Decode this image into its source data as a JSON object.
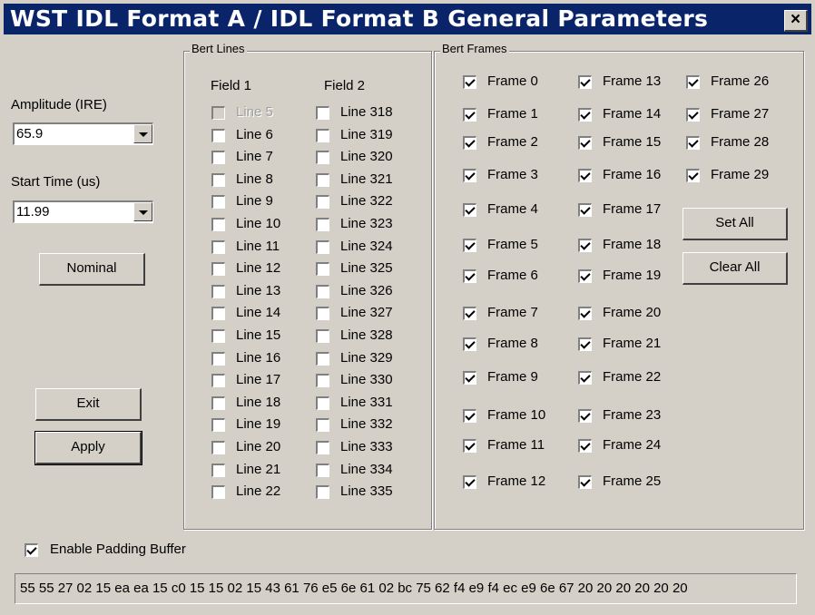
{
  "window": {
    "title": "WST IDL Format A / IDL Format B General Parameters",
    "close_label": "×"
  },
  "left": {
    "amplitude_label": "Amplitude (IRE)",
    "amplitude_value": "65.9",
    "start_time_label": "Start Time (us)",
    "start_time_value": "11.99",
    "nominal_label": "Nominal",
    "exit_label": "Exit",
    "apply_label": "Apply"
  },
  "bert_lines": {
    "legend": "Bert Lines",
    "field1_label": "Field 1",
    "field2_label": "Field 2",
    "field1": [
      {
        "label": "Line 5",
        "checked": false,
        "disabled": true
      },
      {
        "label": "Line 6",
        "checked": false
      },
      {
        "label": "Line 7",
        "checked": false
      },
      {
        "label": "Line 8",
        "checked": false
      },
      {
        "label": "Line 9",
        "checked": false
      },
      {
        "label": "Line 10",
        "checked": false
      },
      {
        "label": "Line 11",
        "checked": false
      },
      {
        "label": "Line 12",
        "checked": false
      },
      {
        "label": "Line 13",
        "checked": false
      },
      {
        "label": "Line 14",
        "checked": false
      },
      {
        "label": "Line 15",
        "checked": false
      },
      {
        "label": "Line 16",
        "checked": false
      },
      {
        "label": "Line 17",
        "checked": false
      },
      {
        "label": "Line 18",
        "checked": false
      },
      {
        "label": "Line 19",
        "checked": false
      },
      {
        "label": "Line 20",
        "checked": false
      },
      {
        "label": "Line 21",
        "checked": false
      },
      {
        "label": "Line 22",
        "checked": false
      }
    ],
    "field2": [
      {
        "label": "Line 318",
        "checked": false
      },
      {
        "label": "Line 319",
        "checked": false
      },
      {
        "label": "Line 320",
        "checked": false
      },
      {
        "label": "Line 321",
        "checked": false
      },
      {
        "label": "Line 322",
        "checked": false
      },
      {
        "label": "Line 323",
        "checked": false
      },
      {
        "label": "Line 324",
        "checked": false
      },
      {
        "label": "Line 325",
        "checked": false
      },
      {
        "label": "Line 326",
        "checked": false
      },
      {
        "label": "Line 327",
        "checked": false
      },
      {
        "label": "Line 328",
        "checked": false
      },
      {
        "label": "Line 329",
        "checked": false
      },
      {
        "label": "Line 330",
        "checked": false
      },
      {
        "label": "Line 331",
        "checked": false
      },
      {
        "label": "Line 332",
        "checked": false
      },
      {
        "label": "Line 333",
        "checked": false
      },
      {
        "label": "Line 334",
        "checked": false
      },
      {
        "label": "Line 335",
        "checked": false
      }
    ]
  },
  "bert_frames": {
    "legend": "Bert Frames",
    "set_all_label": "Set All",
    "clear_all_label": "Clear All",
    "frames": [
      {
        "label": "Frame 0",
        "checked": true
      },
      {
        "label": "Frame 1",
        "checked": true
      },
      {
        "label": "Frame 2",
        "checked": true
      },
      {
        "label": "Frame 3",
        "checked": true
      },
      {
        "label": "Frame 4",
        "checked": true
      },
      {
        "label": "Frame 5",
        "checked": true
      },
      {
        "label": "Frame 6",
        "checked": true
      },
      {
        "label": "Frame 7",
        "checked": true
      },
      {
        "label": "Frame 8",
        "checked": true
      },
      {
        "label": "Frame 9",
        "checked": true
      },
      {
        "label": "Frame 10",
        "checked": true
      },
      {
        "label": "Frame 11",
        "checked": true
      },
      {
        "label": "Frame 12",
        "checked": true
      },
      {
        "label": "Frame 13",
        "checked": true
      },
      {
        "label": "Frame 14",
        "checked": true
      },
      {
        "label": "Frame 15",
        "checked": true
      },
      {
        "label": "Frame 16",
        "checked": true
      },
      {
        "label": "Frame 17",
        "checked": true
      },
      {
        "label": "Frame 18",
        "checked": true
      },
      {
        "label": "Frame 19",
        "checked": true
      },
      {
        "label": "Frame 20",
        "checked": true
      },
      {
        "label": "Frame 21",
        "checked": true
      },
      {
        "label": "Frame 22",
        "checked": true
      },
      {
        "label": "Frame 23",
        "checked": true
      },
      {
        "label": "Frame 24",
        "checked": true
      },
      {
        "label": "Frame 25",
        "checked": true
      },
      {
        "label": "Frame 26",
        "checked": true
      },
      {
        "label": "Frame 27",
        "checked": true
      },
      {
        "label": "Frame 28",
        "checked": true
      },
      {
        "label": "Frame 29",
        "checked": true
      }
    ]
  },
  "padding": {
    "enable_label": "Enable Padding Buffer",
    "enabled": true,
    "hex": "55 55 27 02 15 ea ea 15 c0 15 15 02 15 43 61 76 e5 6e 61 02 bc 75 62 f4 e9 f4 ec e9 6e 67 20 20 20 20 20 20"
  },
  "colors": {
    "titlebar": "#0a246a",
    "face": "#d4d0c8"
  }
}
